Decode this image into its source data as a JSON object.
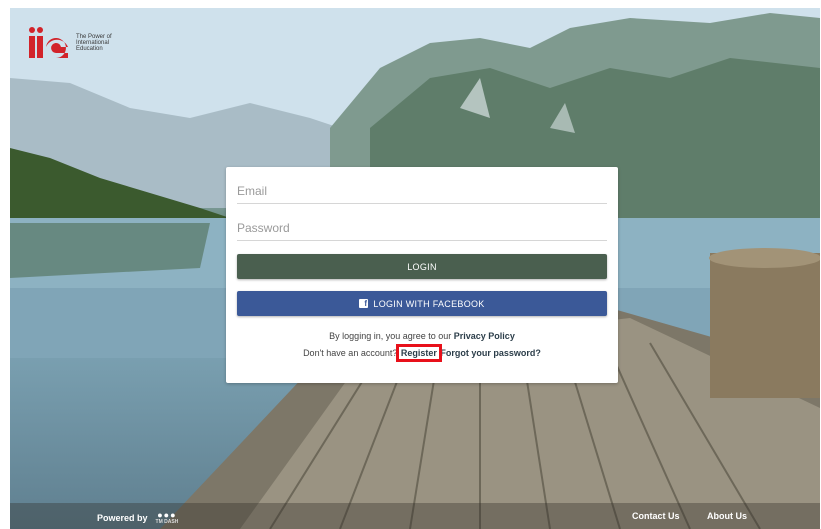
{
  "logo": {
    "mark": "iie",
    "tagline": "The Power of International Education"
  },
  "login_form": {
    "email_placeholder": "Email",
    "password_placeholder": "Password",
    "login_button": "LOGIN",
    "facebook_button": "LOGIN WITH FACEBOOK",
    "facebook_icon": "facebook-icon",
    "agree_prefix": "By logging in, you agree to our",
    "privacy_link": "Privacy Policy",
    "no_account_prefix": "Don't have an account?",
    "register_link": "Register",
    "forgot_link": "Forgot your password?"
  },
  "footer": {
    "powered_by": "Powered by",
    "brand_dots": "●●●",
    "brand_name": "TM DASH",
    "contact_us": "Contact Us",
    "about_us": "About Us"
  },
  "colors": {
    "login_button": "#4a5f4f",
    "facebook_button": "#3b5998",
    "logo_red": "#d2232a",
    "highlight_box": "#e8101a"
  }
}
